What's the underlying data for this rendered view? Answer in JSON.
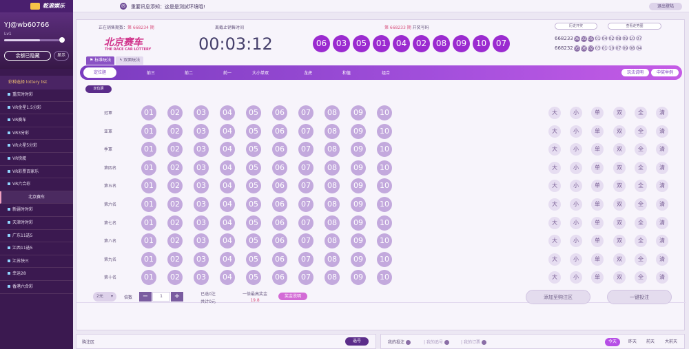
{
  "app": {
    "logo": "乾滚娱乐",
    "notice": "重要讯息添知：这是是测試环境哦!",
    "logout": "退出登陆"
  },
  "user": {
    "name": "YJ@wb60766",
    "level": "Lv1",
    "balance_label": "余额已隐藏",
    "show_label": "显示"
  },
  "sidebar": {
    "title": "彩种选择 lottery list",
    "items": [
      {
        "label": "重庆时时彩"
      },
      {
        "label": "VR金星1.5分彩"
      },
      {
        "label": "VR赛车"
      },
      {
        "label": "VR3分彩"
      },
      {
        "label": "VR火星5分彩"
      },
      {
        "label": "VR快艇"
      },
      {
        "label": "VR彩票百家乐"
      },
      {
        "label": "VR六合彩"
      },
      {
        "label": "北京赛车",
        "sub": true
      },
      {
        "label": "新疆时时彩"
      },
      {
        "label": "天津时时彩"
      },
      {
        "label": "广东11选5"
      },
      {
        "label": "江西11选5"
      },
      {
        "label": "江苏快三"
      },
      {
        "label": "幸运28"
      },
      {
        "label": "香港六合彩"
      }
    ]
  },
  "header": {
    "period_label": "正在销售期数：",
    "period": "第 668234 期",
    "brand": "北京赛车",
    "brand_sub": "THE RACE CAR LOTTERY",
    "countdown_label": "离截止销售时间",
    "countdown": "00:03:12",
    "draw_period": "第 668233 期",
    "draw_label": " 开奖号码",
    "draw_balls": [
      "06",
      "03",
      "05",
      "01",
      "04",
      "02",
      "08",
      "09",
      "10",
      "07"
    ],
    "history_btn": "历史开奖",
    "trend_btn": "查看走势图",
    "history": [
      {
        "period": "668233",
        "balls": [
          "06",
          "03",
          "05",
          "01",
          "04",
          "02",
          "08",
          "09",
          "10",
          "07"
        ]
      },
      {
        "period": "668232",
        "balls": [
          "05",
          "06",
          "02",
          "03",
          "01",
          "10",
          "07",
          "09",
          "08",
          "04"
        ]
      }
    ]
  },
  "tabs": {
    "standard": "标准玩法",
    "double": "双面玩法"
  },
  "nav": {
    "items": [
      "定位胆",
      "前三",
      "前二",
      "前一",
      "大小单双",
      "龙虎",
      "和值",
      "组合"
    ],
    "help": "玩法说明",
    "example": "中奖举例"
  },
  "subtab": "定位胆",
  "rows": [
    "冠軍",
    "亚軍",
    "季軍",
    "第四名",
    "第五名",
    "第六名",
    "第七名",
    "第八名",
    "第九名",
    "第十名"
  ],
  "numbers": [
    "01",
    "02",
    "03",
    "04",
    "05",
    "06",
    "07",
    "08",
    "09",
    "10"
  ],
  "quick": [
    "大",
    "小",
    "单",
    "双",
    "全",
    "清"
  ],
  "footer": {
    "unit": "2元",
    "mult_label": "倍数",
    "minus": "−",
    "mult": "1",
    "plus": "+",
    "selected": "已选0注",
    "total": "共计0元",
    "max_label": "一倍最高奖金",
    "max_value": "19.8",
    "prize_btn": "奖金说明",
    "add_btn": "添加至购注区",
    "bet_btn": "一键投注"
  },
  "bottom": {
    "cart_title": "购注区",
    "choose_btn": "选号",
    "mybets": "我的投注",
    "mytrack": "我的追号",
    "myorders": "我的订票",
    "days": [
      "今天",
      "昨天",
      "前天",
      "大前天"
    ]
  }
}
